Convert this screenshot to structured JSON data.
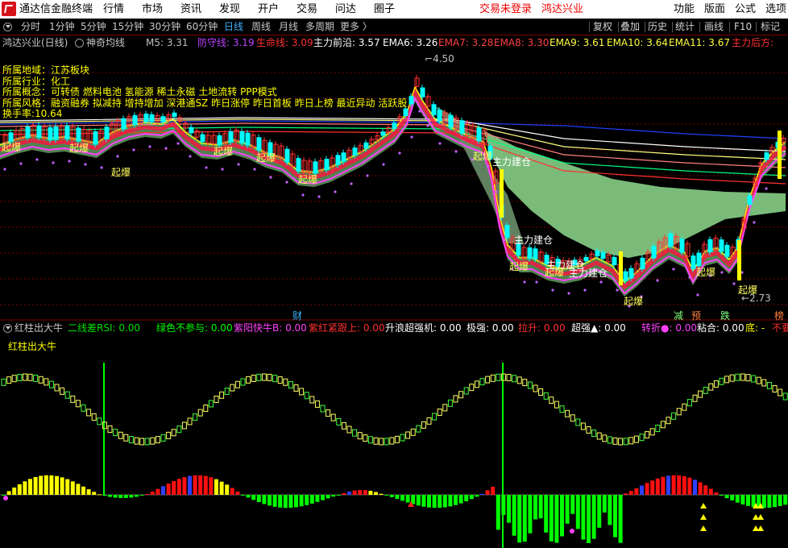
{
  "menubar": {
    "app_title": "通达信金融终端",
    "menus": [
      "行情",
      "市场",
      "资讯",
      "发现",
      "开户",
      "交易",
      "问达",
      "圈子"
    ],
    "trade_status": "交易未登录",
    "stock_name": "鸿达兴业",
    "right_menus": [
      "功能",
      "版面",
      "公式",
      "选项"
    ]
  },
  "toolbar": {
    "periods": [
      "分时",
      "1分钟",
      "5分钟",
      "15分钟",
      "30分钟",
      "60分钟",
      "日线",
      "周线",
      "月线",
      "多周期",
      "更多 〉"
    ],
    "active_period": "日线",
    "right_buttons": [
      "复权",
      "叠加",
      "历史",
      "统计",
      "画线",
      "F10",
      "标记"
    ]
  },
  "main_indicators": {
    "stock_label": "鸿达兴业(日线)",
    "formula_name": "神奇均线",
    "items": [
      {
        "label": "M5: 3.31",
        "color": "#c0c0c0"
      },
      {
        "label": "防守线: 3.19",
        "color": "#c040ff"
      },
      {
        "label": "生命线: 3.09",
        "color": "#ff3030"
      },
      {
        "label": "主力前沿: 3.57",
        "color": "#ffffff"
      },
      {
        "label": "EMA6: 3.26",
        "color": "#ffffff"
      },
      {
        "label": "EMA7: 3.28",
        "color": "#ff4040"
      },
      {
        "label": "EMA8: 3.30",
        "color": "#ff4040"
      },
      {
        "label": "EMA9: 3.61",
        "color": "#ffff40"
      },
      {
        "label": "EMA10: 3.64",
        "color": "#ffff40"
      },
      {
        "label": "EMA11: 3.67",
        "color": "#ffff40"
      },
      {
        "label": "主力后方:",
        "color": "#ff3030"
      }
    ]
  },
  "stock_info": {
    "region": "所属地域：江苏板块",
    "industry": "所属行业：化工",
    "concepts": "所属概念：可转债 燃料电池 氢能源 稀土永磁 土地流转 PPP模式",
    "styles": "所属风格：融资融券 拟减持 增持增加 深港通SZ 昨日涨停 昨日首板 昨日上榜 最近异动 活跃股",
    "turnover": "换手率:10.64"
  },
  "chart_annotations": {
    "high_label": "4.50",
    "low_label": "2.73",
    "signal_qibao": "起爆",
    "signal_zhuli": "主力建仓",
    "markers": [
      "财",
      "减",
      "预",
      "跌",
      "榜"
    ]
  },
  "sub_indicators": {
    "formula_name": "红柱出大牛",
    "items": [
      {
        "label": "二线差RSI: 0.00",
        "color": "#00e000"
      },
      {
        "label": "绿色不参与: 0.00",
        "color": "#00ff00"
      },
      {
        "label": "紫阳快牛B: 0.00",
        "color": "#ff40ff"
      },
      {
        "label": "紫红紧跟上: 0.00",
        "color": "#ff3030"
      },
      {
        "label": "升浪超强机: 0.00",
        "color": "#ffffff"
      },
      {
        "label": "极强: 0.00",
        "color": "#ffffff"
      },
      {
        "label": "拉升: 0.00",
        "color": "#ff3030"
      },
      {
        "label": "超强▲: 0.00",
        "color": "#ffffff"
      },
      {
        "label": "转折●: 0.00",
        "color": "#ff40ff"
      },
      {
        "label": "粘合: 0.00",
        "color": "#ffffff"
      },
      {
        "label": "底: -",
        "color": "#ffff00"
      },
      {
        "label": "不要",
        "color": "#ff3030"
      }
    ],
    "title": "红柱出大牛"
  },
  "colors": {
    "up": "#ff3030",
    "down": "#00ffff",
    "grid": "#7a0000",
    "ribbon_green": "#90ee90",
    "ribbon_red": "#ff1040"
  }
}
